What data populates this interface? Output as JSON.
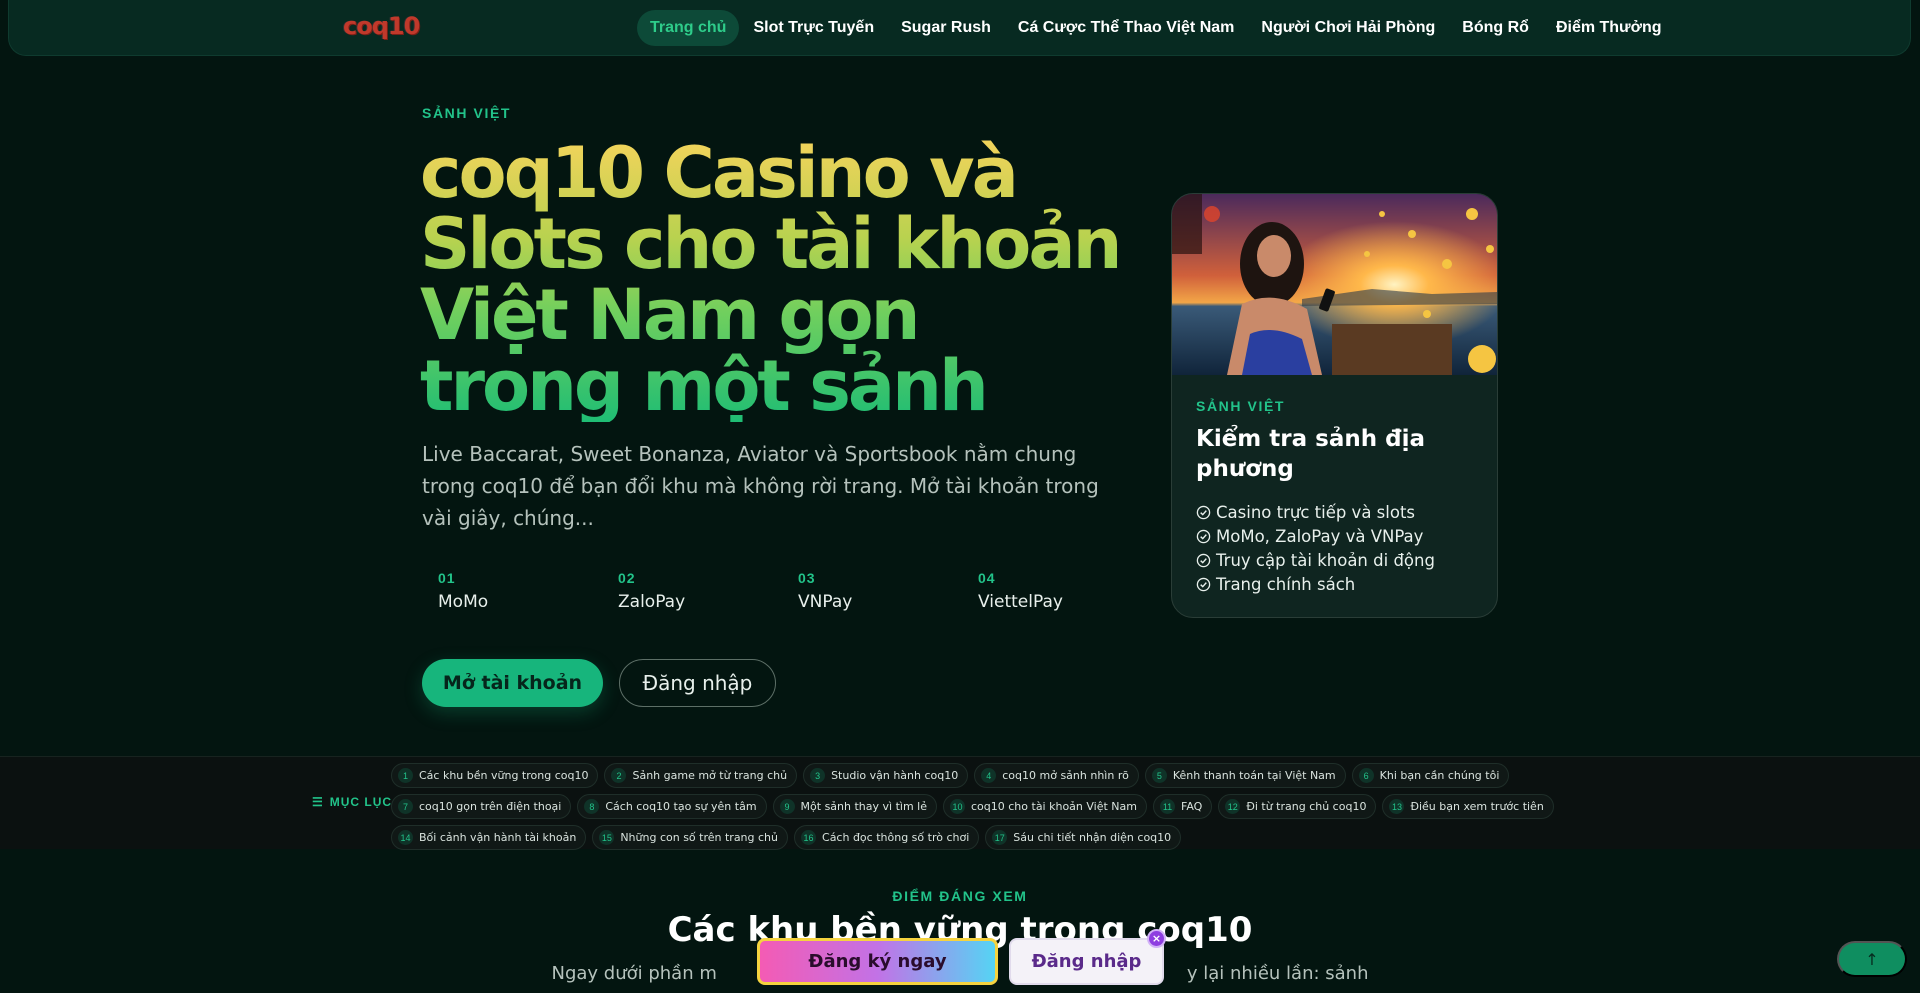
{
  "header": {
    "logo_text": "coq10",
    "nav": [
      {
        "label": "Trang chủ",
        "active": true
      },
      {
        "label": "Slot Trực Tuyến"
      },
      {
        "label": "Sugar Rush"
      },
      {
        "label": "Cá Cược Thể Thao Việt Nam"
      },
      {
        "label": "Người Chơi Hải Phòng"
      },
      {
        "label": "Bóng Rổ"
      },
      {
        "label": "Điểm Thưởng"
      }
    ]
  },
  "hero": {
    "eyebrow": "SẢNH VIỆT",
    "title": "coq10 Casino và Slots cho tài khoản Việt Nam gọn trong một sảnh",
    "subtitle": "Live Baccarat, Sweet Bonanza, Aviator và Sportsbook nằm chung trong coq10 để bạn đổi khu mà không rời trang. Mở tài khoản trong vài giây, chúng...",
    "payments": [
      {
        "num": "01",
        "label": "MoMo"
      },
      {
        "num": "02",
        "label": "ZaloPay"
      },
      {
        "num": "03",
        "label": "VNPay"
      },
      {
        "num": "04",
        "label": "ViettelPay"
      }
    ],
    "primary_button": "Mở tài khoản",
    "secondary_button": "Đăng nhập"
  },
  "card": {
    "eyebrow": "SẢNH VIỆT",
    "title": "Kiểm tra sảnh địa phương",
    "items": [
      "Casino trực tiếp và slots",
      "MoMo, ZaloPay và VNPay",
      "Truy cập tài khoản di động",
      "Trang chính sách"
    ]
  },
  "toc": {
    "label": "MỤC LỤC",
    "rows": [
      [
        {
          "num": "1",
          "text": "Các khu bền vững trong coq10"
        },
        {
          "num": "2",
          "text": "Sảnh game mở từ trang chủ"
        },
        {
          "num": "3",
          "text": "Studio vận hành coq10"
        },
        {
          "num": "4",
          "text": "coq10 mở sảnh nhìn rõ"
        },
        {
          "num": "5",
          "text": "Kênh thanh toán tại Việt Nam"
        },
        {
          "num": "6",
          "text": "Khi bạn cần chúng tôi"
        }
      ],
      [
        {
          "num": "7",
          "text": "coq10 gọn trên điện thoại"
        },
        {
          "num": "8",
          "text": "Cách coq10 tạo sự yên tâm"
        },
        {
          "num": "9",
          "text": "Một sảnh thay vì tìm lẻ"
        },
        {
          "num": "10",
          "text": "coq10 cho tài khoản Việt Nam"
        },
        {
          "num": "11",
          "text": "FAQ"
        },
        {
          "num": "12",
          "text": "Đi từ trang chủ coq10"
        },
        {
          "num": "13",
          "text": "Điều bạn xem trước tiên"
        }
      ],
      [
        {
          "num": "14",
          "text": "Bối cảnh vận hành tài khoản"
        },
        {
          "num": "15",
          "text": "Những con số trên trang chủ"
        },
        {
          "num": "16",
          "text": "Cách đọc thông số trò chơi"
        },
        {
          "num": "17",
          "text": "Sáu chi tiết nhận diện coq10"
        }
      ]
    ]
  },
  "section": {
    "eyebrow": "ĐIỂM ĐÁNG XEM",
    "title": "Các khu bền vững trong coq10",
    "subtitle_left": "Ngay dưới phần m",
    "subtitle_right": "y lại nhiều lần: sảnh"
  },
  "sticky": {
    "signup": "Đăng ký ngay",
    "login": "Đăng nhập",
    "close": "×"
  },
  "back_to_top": "↑",
  "colors": {
    "bg": "#031510",
    "accent": "#22c38a",
    "button": "#17b57c"
  }
}
